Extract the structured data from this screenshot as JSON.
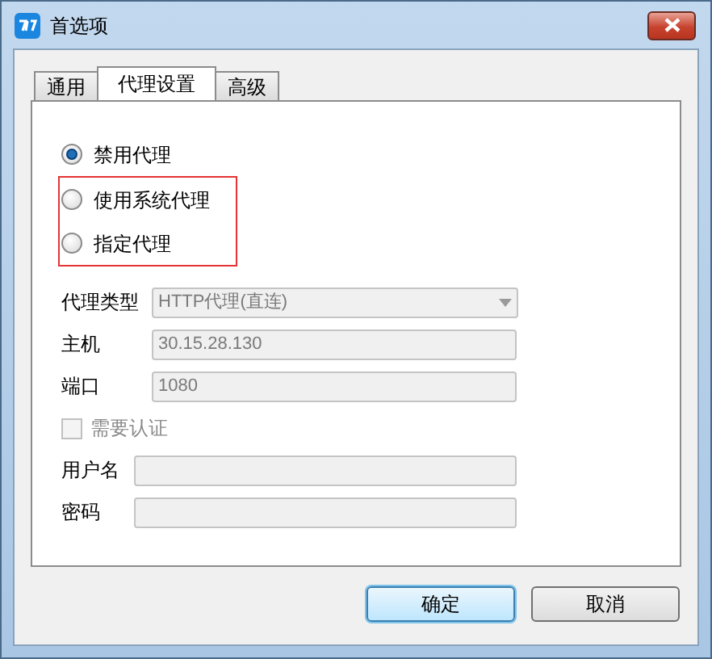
{
  "window": {
    "title": "首选项"
  },
  "tabs": [
    {
      "label": "通用",
      "selected": false
    },
    {
      "label": "代理设置",
      "selected": true
    },
    {
      "label": "高级",
      "selected": false
    }
  ],
  "proxy_modes": [
    {
      "label": "禁用代理",
      "selected": true,
      "highlighted": false
    },
    {
      "label": "使用系统代理",
      "selected": false,
      "highlighted": true
    },
    {
      "label": "指定代理",
      "selected": false,
      "highlighted": true
    }
  ],
  "proxy_type": {
    "label": "代理类型",
    "value": "HTTP代理(直连)",
    "disabled": true
  },
  "host": {
    "label": "主机",
    "value": "30.15.28.130",
    "disabled": true
  },
  "port": {
    "label": "端口",
    "value": "1080",
    "disabled": true
  },
  "auth": {
    "label": "需要认证",
    "checked": false,
    "disabled": true
  },
  "username": {
    "label": "用户名",
    "disabled": true
  },
  "password": {
    "label": "密码",
    "disabled": true
  },
  "buttons": [
    {
      "label": "确定",
      "default": true
    },
    {
      "label": "取消",
      "default": false
    }
  ]
}
